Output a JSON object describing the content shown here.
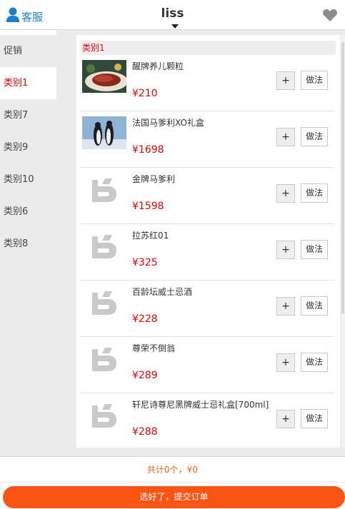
{
  "header": {
    "service_label": "客服",
    "title": "liss"
  },
  "sidebar": {
    "items": [
      {
        "label": "促销",
        "active": false
      },
      {
        "label": "类别1",
        "active": true
      },
      {
        "label": "类别7",
        "active": false
      },
      {
        "label": "类别9",
        "active": false
      },
      {
        "label": "类别10",
        "active": false
      },
      {
        "label": "类别6",
        "active": false
      },
      {
        "label": "类别8",
        "active": false
      }
    ]
  },
  "content": {
    "category_title": "类别1",
    "plus_label": "+",
    "method_label": "做法",
    "products": [
      {
        "name": "醒牌养儿颗粒",
        "price": "¥210",
        "image": "steak-photo"
      },
      {
        "name": "法国马爹利XO礼盒",
        "price": "¥1698",
        "image": "penguin-photo"
      },
      {
        "name": "金牌马爹利",
        "price": "¥1598",
        "image": "placeholder-logo"
      },
      {
        "name": "拉苏红01",
        "price": "¥325",
        "image": "placeholder-logo"
      },
      {
        "name": "百龄坛威士忌酒",
        "price": "¥228",
        "image": "placeholder-logo"
      },
      {
        "name": "尊荣不倒翁",
        "price": "¥289",
        "image": "placeholder-logo"
      },
      {
        "name": "轩尼诗尊尼黑牌威士忌礼盒[700ml]",
        "price": "¥288",
        "image": "placeholder-logo"
      }
    ]
  },
  "footer": {
    "total": "共计0个，¥0",
    "submit": "选好了，提交订单"
  },
  "colors": {
    "accent_red": "#e00000",
    "link_blue": "#1a7fd4",
    "submit_orange": "#fa5514",
    "total_orange": "#f06414"
  }
}
